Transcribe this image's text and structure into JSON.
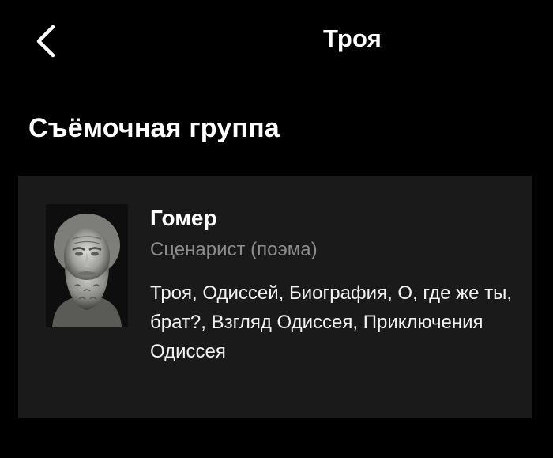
{
  "header": {
    "title": "Троя",
    "back_icon": "chevron-left-icon"
  },
  "section": {
    "heading": "Съёмочная группа"
  },
  "crew": [
    {
      "name": "Гомер",
      "role": "Сценарист (поэма)",
      "works": "Троя, Одиссей, Биография, О, где же ты, брат?, Взгляд Одиссея, Приключения Одиссея",
      "photo": "bust-portrait"
    }
  ],
  "colors": {
    "background": "#000000",
    "card": "#1a1a1a",
    "text_primary": "#ffffff",
    "text_secondary": "#8c8c8c"
  }
}
